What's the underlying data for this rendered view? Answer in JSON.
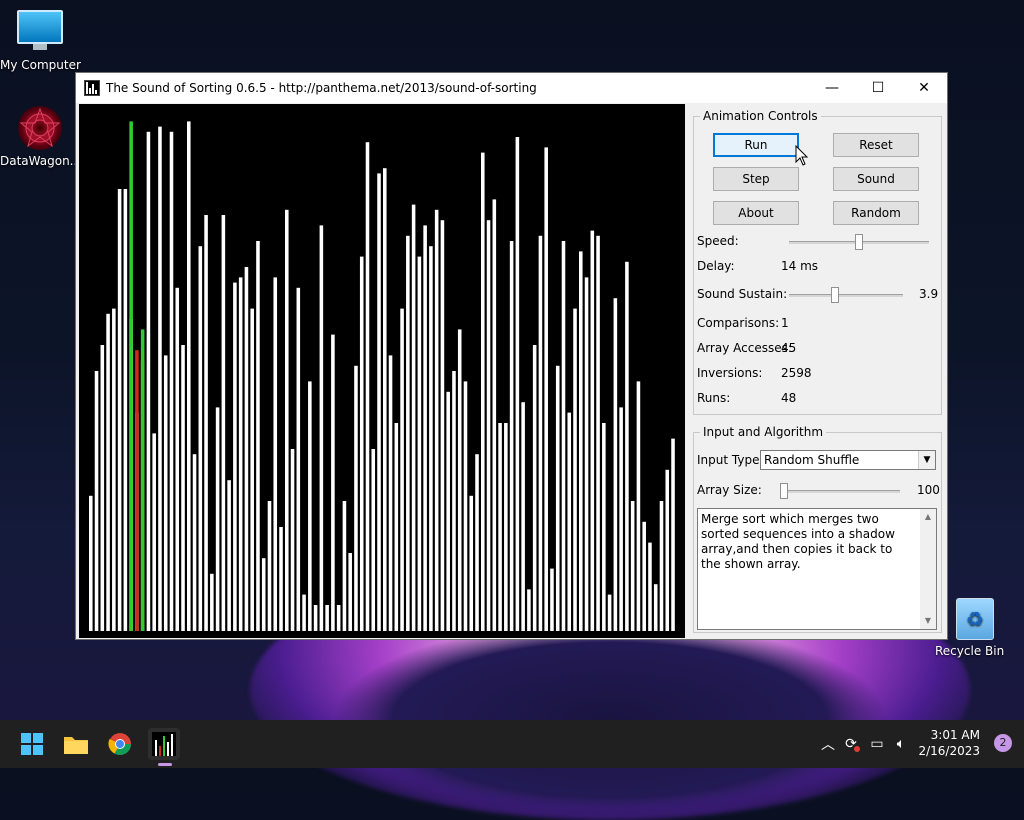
{
  "desktop": {
    "icons": [
      {
        "label": "My Computer"
      },
      {
        "label": "DataWagon..."
      },
      {
        "label": "Recycle Bin"
      }
    ]
  },
  "window": {
    "title": "The Sound of Sorting 0.6.5 - http://panthema.net/2013/sound-of-sorting",
    "minimize_glyph": "—",
    "maximize_glyph": "☐",
    "close_glyph": "✕"
  },
  "array_display": {
    "bar_color": "#ffffff",
    "highlight_green": "#2ecc2e",
    "highlight_red": "#d22a1a",
    "values": [
      26,
      50,
      55,
      61,
      62,
      85,
      85,
      60,
      42,
      52,
      96,
      38,
      97,
      53,
      96,
      66,
      55,
      98,
      34,
      74,
      80,
      11,
      43,
      80,
      29,
      67,
      68,
      70,
      62,
      75,
      14,
      25,
      68,
      20,
      81,
      35,
      66,
      7,
      48,
      5,
      78,
      5,
      57,
      5,
      25,
      15,
      51,
      72,
      94,
      35,
      88,
      89,
      53,
      40,
      62,
      76,
      82,
      72,
      78,
      74,
      81,
      79,
      46,
      50,
      58,
      48,
      26,
      34,
      92,
      79,
      83,
      40,
      40,
      75,
      95,
      44,
      8,
      55,
      76,
      93,
      12,
      51,
      75,
      42,
      62,
      73,
      68,
      77,
      76,
      40,
      7,
      64,
      43,
      71,
      25,
      48,
      21,
      17,
      9,
      25,
      31,
      37
    ],
    "highlights": [
      {
        "index": 7,
        "value": 98,
        "color": "green"
      },
      {
        "index": 8,
        "value": 54,
        "color": "red"
      },
      {
        "index": 9,
        "value": 58,
        "color": "green"
      }
    ]
  },
  "animation_controls": {
    "title": "Animation Controls",
    "buttons": {
      "run": "Run",
      "reset": "Reset",
      "step": "Step",
      "sound": "Sound",
      "about": "About",
      "random": "Random"
    },
    "speed_label": "Speed:",
    "speed_level": 0.5,
    "delay_label": "Delay:",
    "delay_value": "14 ms",
    "sustain_label": "Sound Sustain:",
    "sustain_level": 0.4,
    "sustain_value": "3.9",
    "stats": [
      {
        "label": "Comparisons:",
        "value": "1"
      },
      {
        "label": "Array Accesses:",
        "value": "45"
      },
      {
        "label": "Inversions:",
        "value": "2598"
      },
      {
        "label": "Runs:",
        "value": "48"
      }
    ]
  },
  "input_algorithm": {
    "title": "Input and Algorithm",
    "input_type_label": "Input Type:",
    "input_type_value": "Random Shuffle",
    "array_size_label": "Array Size:",
    "array_size_value": "100",
    "array_size_level": 0.0,
    "description": "Merge sort which merges two sorted sequences into a shadow array,and then copies it back to the shown array."
  },
  "taskbar": {
    "time": "3:01 AM",
    "date": "2/16/2023",
    "notification_count": "2"
  }
}
